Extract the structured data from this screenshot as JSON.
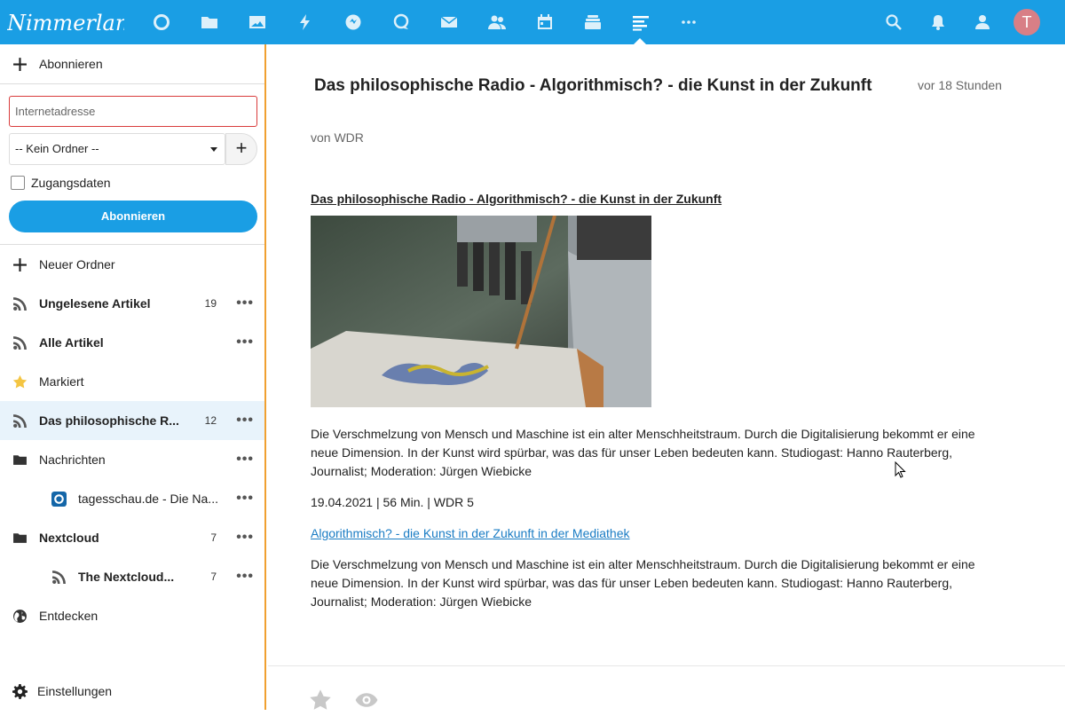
{
  "topbar": {
    "brand": "Nimmerland",
    "apps": [
      "dashboard-icon",
      "files-icon",
      "photos-icon",
      "activity-icon",
      "talk-icon",
      "search-bubble-icon",
      "mail-icon",
      "contacts-icon",
      "calendar-icon",
      "deck-icon",
      "news-icon",
      "more-apps-icon"
    ],
    "active_app": "news-icon",
    "avatar_initial": "T",
    "accent": "#1a9ee4"
  },
  "sidebar": {
    "subscribe_label": "Abonnieren",
    "url_placeholder": "Internetadresse",
    "folder_select_value": "-- Kein Ordner --",
    "credentials_label": "Zugangsdaten",
    "subscribe_button": "Abonnieren",
    "new_folder_label": "Neuer Ordner",
    "items": [
      {
        "label": "Ungelesene Artikel",
        "count": "19",
        "icon": "rss-icon",
        "bold": true
      },
      {
        "label": "Alle Artikel",
        "count": "",
        "icon": "rss-icon",
        "bold": true
      },
      {
        "label": "Markiert",
        "count": "",
        "icon": "star-icon",
        "bold": false
      },
      {
        "label": "Das philosophische R...",
        "count": "12",
        "icon": "rss-icon",
        "bold": true
      },
      {
        "label": "Nachrichten",
        "count": "",
        "icon": "folder-icon",
        "bold": false
      },
      {
        "label": "tagesschau.de - Die Na...",
        "count": "",
        "icon": "tagesschau-icon",
        "bold": false
      },
      {
        "label": "Nextcloud",
        "count": "7",
        "icon": "folder-icon",
        "bold": true
      },
      {
        "label": "The Nextcloud...",
        "count": "7",
        "icon": "rss-icon",
        "bold": true
      },
      {
        "label": "Entdecken",
        "count": "",
        "icon": "globe-icon",
        "bold": false
      }
    ],
    "settings_label": "Einstellungen",
    "more_glyph": "•••"
  },
  "article": {
    "title": "Das philosophische Radio - Algorithmisch? - die Kunst in der Zukunft",
    "time": "vor 18 Stunden",
    "author": "von WDR",
    "heading": "Das philosophische Radio - Algorithmisch? - die Kunst in der Zukunft",
    "paragraph1": "Die Verschmelzung von Mensch und Maschine ist ein alter Menschheitstraum. Durch die Digitalisierung bekommt er eine neue Dimension. In der Kunst wird spürbar, was das für unser Leben bedeuten kann. Studiogast: Hanno Rauterberg, Journalist; Moderation: Jürgen Wiebicke",
    "meta": "19.04.2021 | 56 Min. | WDR 5",
    "link": "Algorithmisch? - die Kunst in der Zukunft in der Mediathek",
    "paragraph2": "Die Verschmelzung von Mensch und Maschine ist ein alter Menschheitstraum. Durch die Digitalisierung bekommt er eine neue Dimension. In der Kunst wird spürbar, was das für unser Leben bedeuten kann. Studiogast: Hanno Rauterberg, Journalist; Moderation: Jürgen Wiebicke"
  }
}
